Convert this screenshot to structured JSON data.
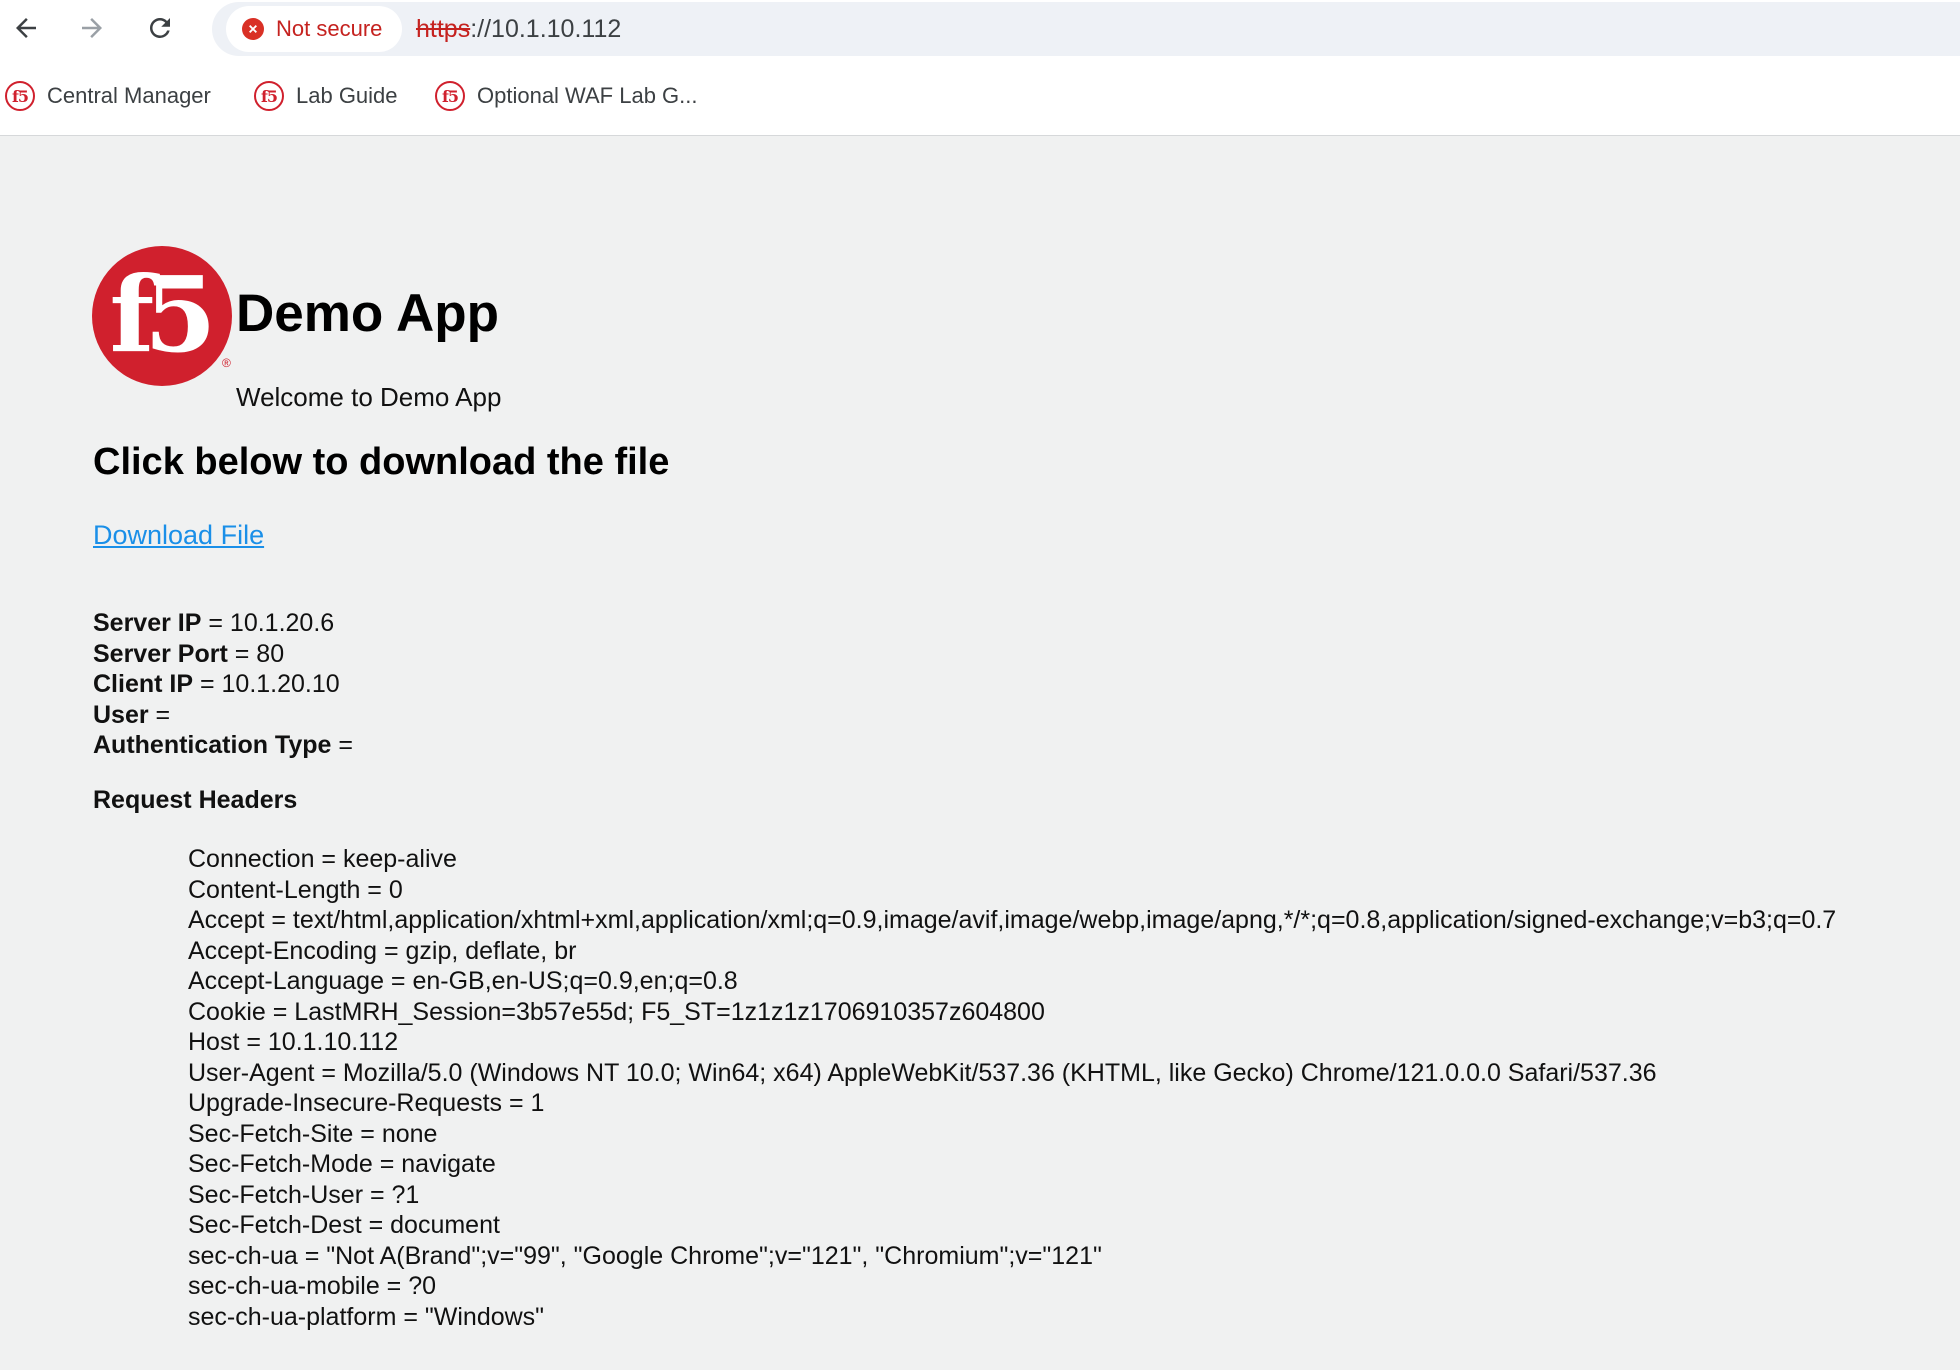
{
  "browser": {
    "security_label": "Not secure",
    "url_protocol": "https",
    "url_rest": "://10.1.10.112",
    "bookmarks": [
      {
        "label": "Central Manager"
      },
      {
        "label": "Lab Guide"
      },
      {
        "label": "Optional WAF Lab G..."
      }
    ],
    "bookmark_icon_text": "f5"
  },
  "page": {
    "logo_text": "f5",
    "logo_reg": "®",
    "title": "Demo App",
    "welcome": "Welcome to Demo App",
    "download_heading": "Click below to download the file",
    "download_link": "Download File",
    "info": [
      {
        "key": "Server IP",
        "value": " = 10.1.20.6"
      },
      {
        "key": "Server Port",
        "value": " = 80"
      },
      {
        "key": "Client IP",
        "value": " = 10.1.20.10"
      },
      {
        "key": "User",
        "value": " ="
      },
      {
        "key": "Authentication Type",
        "value": " ="
      }
    ],
    "request_headers_title": "Request Headers",
    "headers": [
      "Connection = keep-alive",
      "Content-Length = 0",
      "Accept = text/html,application/xhtml+xml,application/xml;q=0.9,image/avif,image/webp,image/apng,*/*;q=0.8,application/signed-exchange;v=b3;q=0.7",
      "Accept-Encoding = gzip, deflate, br",
      "Accept-Language = en-GB,en-US;q=0.9,en;q=0.8",
      "Cookie = LastMRH_Session=3b57e55d; F5_ST=1z1z1z1706910357z604800",
      "Host = 10.1.10.112",
      "User-Agent = Mozilla/5.0 (Windows NT 10.0; Win64; x64) AppleWebKit/537.36 (KHTML, like Gecko) Chrome/121.0.0.0 Safari/537.36",
      "Upgrade-Insecure-Requests = 1",
      "Sec-Fetch-Site = none",
      "Sec-Fetch-Mode = navigate",
      "Sec-Fetch-User = ?1",
      "Sec-Fetch-Dest = document",
      "sec-ch-ua = \"Not A(Brand\";v=\"99\", \"Google Chrome\";v=\"121\", \"Chromium\";v=\"121\"",
      "sec-ch-ua-mobile = ?0",
      "sec-ch-ua-platform = \"Windows\""
    ]
  },
  "colors": {
    "f5_red": "#d0202d",
    "link_blue": "#1a8fe8",
    "not_secure_red": "#c5221f"
  }
}
